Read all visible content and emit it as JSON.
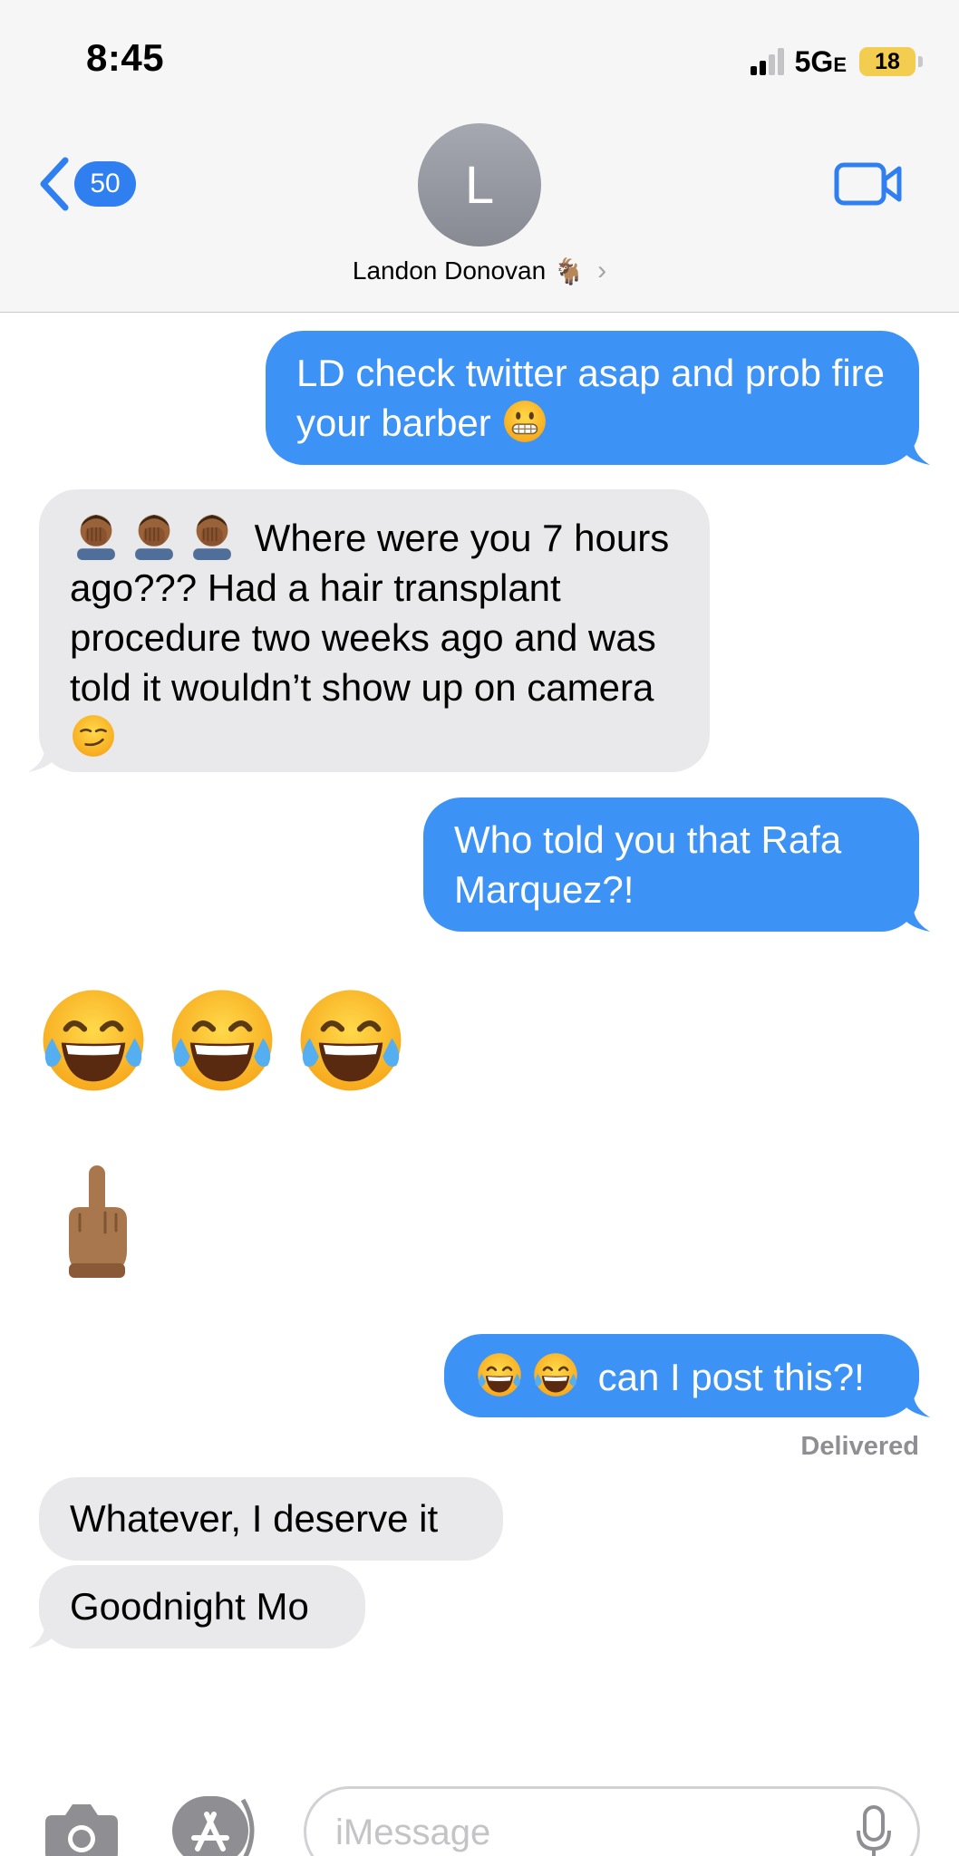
{
  "status_bar": {
    "time": "8:45",
    "network": "5G",
    "network_suffix": "E",
    "battery": "18"
  },
  "nav": {
    "back_count": "50",
    "avatar_initial": "L",
    "contact_name": "Landon Donovan",
    "contact_emoji": "🐐",
    "contact_chevron": "›"
  },
  "messages": [
    {
      "direction": "outgoing",
      "text": "LD check twitter asap and prob fire your barber",
      "emoji": "grimacing-face"
    },
    {
      "direction": "incoming",
      "leading_emoji": [
        "face-palm",
        "face-palm",
        "face-palm"
      ],
      "text": "Where were you 7 hours ago??? Had a hair transplant procedure two weeks ago and was told it wouldn’t show up on camera",
      "emoji": "smirking-face"
    },
    {
      "direction": "outgoing",
      "text": "Who told you that Rafa Marquez?!"
    },
    {
      "direction": "incoming",
      "big_emoji": [
        "tears-of-joy",
        "tears-of-joy",
        "tears-of-joy"
      ]
    },
    {
      "direction": "incoming",
      "big_emoji": [
        "middle-finger"
      ]
    },
    {
      "direction": "outgoing",
      "leading_emoji": [
        "tears-of-joy",
        "tears-of-joy"
      ],
      "text": "can I post this?!",
      "status": "Delivered"
    },
    {
      "direction": "incoming",
      "text": "Whatever, I deserve it"
    },
    {
      "direction": "incoming",
      "text": "Goodnight Mo"
    }
  ],
  "composer": {
    "placeholder": "iMessage"
  },
  "colors": {
    "outgoing_bubble": "#3d92f5",
    "incoming_bubble": "#e9e9eb",
    "accent": "#2f7ff0"
  }
}
